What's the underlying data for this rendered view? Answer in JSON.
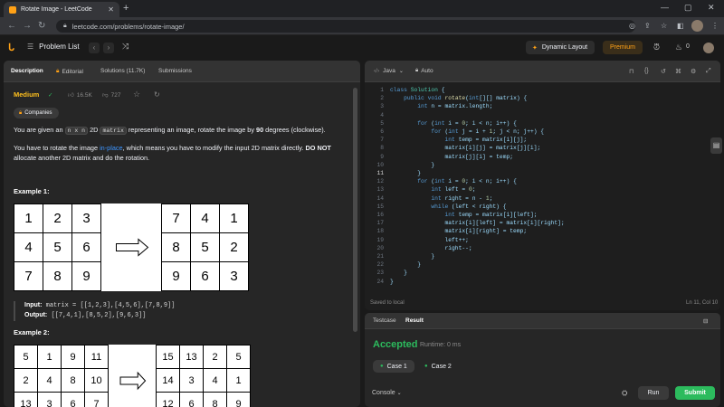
{
  "browser": {
    "tab_title": "Rotate Image - LeetCode",
    "url": "leetcode.com/problems/rotate-image/"
  },
  "nav": {
    "problem_list": "Problem List",
    "dynamic_layout": "Dynamic Layout",
    "premium": "Premium",
    "streak": "0"
  },
  "left_tabs": {
    "description": "Description",
    "editorial": "Editorial",
    "solutions": "Solutions (11.7K)",
    "submissions": "Submissions"
  },
  "problem": {
    "difficulty": "Medium",
    "likes": "16.5K",
    "dislikes": "727",
    "companies": "Companies",
    "p1_a": "You are given an ",
    "p1_code1": "n x n",
    "p1_b": " 2D ",
    "p1_code2": "matrix",
    "p1_c": " representing an image, rotate the image by ",
    "p1_bold": "90",
    "p1_d": " degrees (clockwise).",
    "p2_a": "You have to rotate the image ",
    "p2_link": "in-place",
    "p2_b": ", which means you have to modify the input 2D matrix directly. ",
    "p2_bold": "DO NOT",
    "p2_c": "allocate another 2D matrix and do the rotation.",
    "example1_title": "Example 1:",
    "example1_input_label": "Input:",
    "example1_input": " matrix = [[1,2,3],[4,5,6],[7,8,9]]",
    "example1_output_label": "Output:",
    "example1_output": " [[7,4,1],[8,5,2],[9,6,3]]",
    "example2_title": "Example 2:",
    "ex1_before": [
      [
        "1",
        "2",
        "3"
      ],
      [
        "4",
        "5",
        "6"
      ],
      [
        "7",
        "8",
        "9"
      ]
    ],
    "ex1_after": [
      [
        "7",
        "4",
        "1"
      ],
      [
        "8",
        "5",
        "2"
      ],
      [
        "9",
        "6",
        "3"
      ]
    ],
    "ex2_before": [
      [
        "5",
        "1",
        "9",
        "11"
      ],
      [
        "2",
        "4",
        "8",
        "10"
      ],
      [
        "13",
        "3",
        "6",
        "7"
      ]
    ],
    "ex2_after": [
      [
        "15",
        "13",
        "2",
        "5"
      ],
      [
        "14",
        "3",
        "4",
        "1"
      ],
      [
        "12",
        "6",
        "8",
        "9"
      ]
    ]
  },
  "editor": {
    "language": "Java",
    "mode": "Auto",
    "saved": "Saved to local",
    "cursor": "Ln 11, Col 10",
    "lines": [
      "class Solution {",
      "    public void rotate(int[][] matrix) {",
      "        int n = matrix.length;",
      "",
      "        for (int i = 0; i < n; i++) {",
      "            for (int j = i + 1; j < n; j++) {",
      "                int temp = matrix[i][j];",
      "                matrix[i][j] = matrix[j][i];",
      "                matrix[j][i] = temp;",
      "            }",
      "        }",
      "        for (int i = 0; i < n; i++) {",
      "            int left = 0;",
      "            int right = n - 1;",
      "            while (left < right) {",
      "                int temp = matrix[i][left];",
      "                matrix[i][left] = matrix[i][right];",
      "                matrix[i][right] = temp;",
      "                left++;",
      "                right--;",
      "            }",
      "        }",
      "    }",
      "}"
    ]
  },
  "result": {
    "tab_testcase": "Testcase",
    "tab_result": "Result",
    "status": "Accepted",
    "runtime": "Runtime: 0 ms",
    "case1": "Case 1",
    "case2": "Case 2",
    "console": "Console",
    "run": "Run",
    "submit": "Submit"
  }
}
